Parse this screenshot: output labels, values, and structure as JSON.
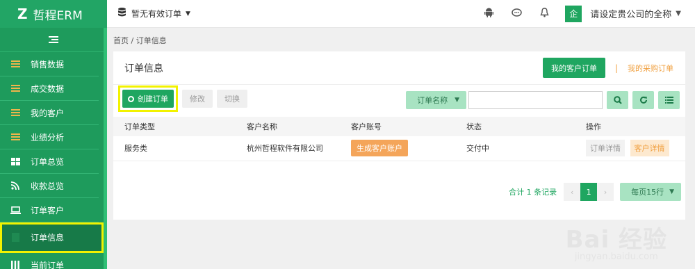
{
  "brand": {
    "logo": "Z",
    "name": "哲程ERM"
  },
  "sidebar": {
    "items": [
      {
        "label": "销售数据",
        "icon": "bars-icon"
      },
      {
        "label": "成交数据",
        "icon": "bars-icon"
      },
      {
        "label": "我的客户",
        "icon": "bars-icon"
      },
      {
        "label": "业绩分析",
        "icon": "bars-icon"
      },
      {
        "label": "订单总览",
        "icon": "grid-icon"
      },
      {
        "label": "收款总览",
        "icon": "rss-icon"
      },
      {
        "label": "订单客户",
        "icon": "laptop-icon"
      },
      {
        "label": "订单信息",
        "icon": "document-icon",
        "active": true
      },
      {
        "label": "当前订单",
        "icon": "columns-icon"
      }
    ]
  },
  "topbar": {
    "order_select": "暂无有效订单",
    "avatar_text": "企",
    "company_name": "请设定贵公司的全称"
  },
  "breadcrumb": "首页 / 订单信息",
  "panel": {
    "title": "订单信息",
    "tab_customer": "我的客户订单",
    "tab_separator": "|",
    "tab_purchase": "我的采购订单"
  },
  "toolbar": {
    "create": "创建订单",
    "edit": "修改",
    "switch": "切换",
    "field_select": "订单名称",
    "search_placeholder": ""
  },
  "table": {
    "headers": [
      "订单类型",
      "客户名称",
      "客户账号",
      "状态",
      "操作"
    ],
    "rows": [
      {
        "type": "服务类",
        "customer": "杭州哲程软件有限公司",
        "account_action": "生成客户账户",
        "status": "交付中",
        "detail_order": "订单详情",
        "detail_customer": "客户详情"
      }
    ]
  },
  "pager": {
    "total": "合计 1 条记录",
    "current_page": "1",
    "per_page": "每页15行"
  },
  "watermark": {
    "main": "Bai 经验",
    "sub": "jingyan.baidu.com"
  },
  "colors": {
    "brand_green": "#1fa660",
    "sidebar_green": "#1e9b5c",
    "accent_orange": "#f0a040",
    "highlight_yellow": "#f2f200"
  }
}
